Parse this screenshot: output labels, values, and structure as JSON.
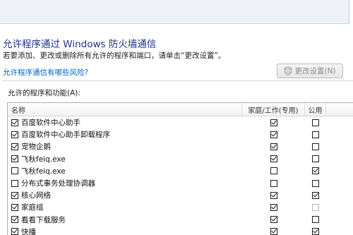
{
  "header": {
    "title": "允许程序通过 Windows 防火墙通信",
    "description": "若要添加、更改或删除所有允许的程序和端口，请单击“更改设置”。",
    "risk_link": "允许程序通信有哪些风险?",
    "change_settings_label": "更改设置(N)",
    "change_settings_icon": "shield-icon"
  },
  "list": {
    "label": "允许的程序和功能(A):",
    "columns": {
      "name": "名称",
      "home_work": "家庭/工作(专用)",
      "public": "公用"
    },
    "rows": [
      {
        "name": "百度软件中心助手",
        "enabled": true,
        "home": true,
        "public": false
      },
      {
        "name": "百度软件中心助手卸载程序",
        "enabled": true,
        "home": true,
        "public": false
      },
      {
        "name": "宠物企鹅",
        "enabled": true,
        "home": true,
        "public": false
      },
      {
        "name": "飞秋feiq.exe",
        "enabled": true,
        "home": true,
        "public": false
      },
      {
        "name": "飞秋feiq.exe",
        "enabled": false,
        "home": false,
        "public": true
      },
      {
        "name": "分布式事务处理协调器",
        "enabled": false,
        "home": false,
        "public": false
      },
      {
        "name": "核心网络",
        "enabled": true,
        "home": true,
        "public": true
      },
      {
        "name": "家庭组",
        "enabled": true,
        "home": true,
        "public": false
      },
      {
        "name": "看看下载服务",
        "enabled": true,
        "home": true,
        "public": false
      },
      {
        "name": "快播",
        "enabled": true,
        "home": true,
        "public": true
      }
    ]
  },
  "colors": {
    "title": "#1e3287",
    "link": "#0066cc",
    "disabled_text": "#8a8a8a"
  }
}
